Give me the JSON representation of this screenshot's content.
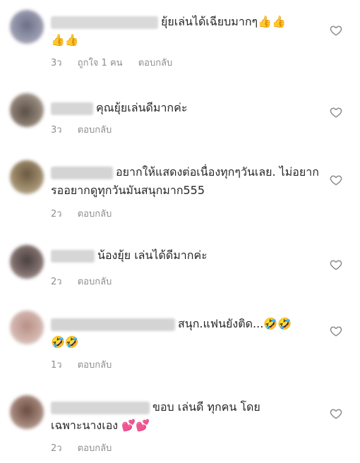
{
  "comments": [
    {
      "text": "ยุ้ยเล่นได้เฉียบมากๆ👍👍👍👍",
      "time": "3ว",
      "likes": "ถูกใจ 1 คน",
      "reply": "ตอบกลับ"
    },
    {
      "text": "คุณยุ้ยเล่นดีมากค่ะ",
      "time": "3ว",
      "reply": "ตอบกลับ"
    },
    {
      "text": "อยากให้แสดงต่อเนื่องทุกๆวันเลย. ไม่อยากรออยากดูทุกวันมันสนุกมาก555",
      "time": "2ว",
      "reply": "ตอบกลับ"
    },
    {
      "text": "น้องยุ้ย เล่นได้ดีมากค่ะ",
      "time": "2ว",
      "reply": "ตอบกลับ"
    },
    {
      "text": "สนุก.แฟนยังติด...🤣🤣🤣🤣",
      "time": "1ว",
      "reply": "ตอบกลับ"
    },
    {
      "text": "ขอบ เล่นดี ทุกคน โดยเฉพาะนางเอง 💕💕",
      "time": "2ว",
      "reply": "ตอบกลับ"
    }
  ],
  "icons": {
    "like": "heart-outline-icon"
  },
  "colors": {
    "meta": "#8e8e8e",
    "text": "#262626",
    "icon": "#8e8e8e"
  }
}
